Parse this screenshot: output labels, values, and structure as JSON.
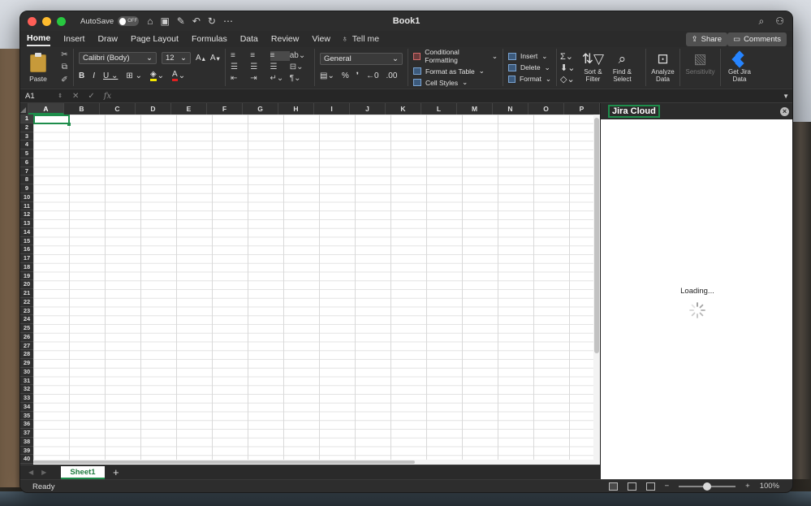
{
  "window": {
    "title": "Book1",
    "autosave_label": "AutoSave",
    "autosave_state": "OFF"
  },
  "tabs": [
    {
      "label": "Home",
      "active": true
    },
    {
      "label": "Insert"
    },
    {
      "label": "Draw"
    },
    {
      "label": "Page Layout"
    },
    {
      "label": "Formulas"
    },
    {
      "label": "Data"
    },
    {
      "label": "Review"
    },
    {
      "label": "View"
    }
  ],
  "tell_me": "Tell me",
  "share_label": "Share",
  "comments_label": "Comments",
  "ribbon": {
    "paste_label": "Paste",
    "font_name": "Calibri (Body)",
    "font_size": "12",
    "number_format": "General",
    "conditional_formatting": "Conditional Formatting",
    "format_as_table": "Format as Table",
    "cell_styles": "Cell Styles",
    "insert": "Insert",
    "delete": "Delete",
    "format": "Format",
    "sort_filter": "Sort & Filter",
    "find_select": "Find & Select",
    "analyze_data": "Analyze Data",
    "sensitivity": "Sensitivity",
    "get_jira_data": "Get Jira Data"
  },
  "formula_bar": {
    "name_box": "A1",
    "fx": "fx",
    "value": ""
  },
  "columns": [
    "A",
    "B",
    "C",
    "D",
    "E",
    "F",
    "G",
    "H",
    "I",
    "J",
    "K",
    "L",
    "M",
    "N",
    "O",
    "P"
  ],
  "rows": [
    "1",
    "2",
    "3",
    "4",
    "5",
    "6",
    "7",
    "8",
    "9",
    "10",
    "11",
    "12",
    "13",
    "14",
    "15",
    "16",
    "17",
    "18",
    "19",
    "20",
    "21",
    "22",
    "23",
    "24",
    "25",
    "26",
    "27",
    "28",
    "29",
    "30",
    "31",
    "32",
    "33",
    "34",
    "35",
    "36",
    "37",
    "38",
    "39",
    "40"
  ],
  "sheet_tabs": [
    {
      "label": "Sheet1",
      "active": true
    }
  ],
  "task_pane": {
    "title": "Jira Cloud",
    "loading_text": "Loading..."
  },
  "status": {
    "text": "Ready",
    "zoom": "100%",
    "zoom_fraction": 0.5
  },
  "colors": {
    "accent_green": "#1e8d4b",
    "jira_blue": "#2684ff"
  }
}
